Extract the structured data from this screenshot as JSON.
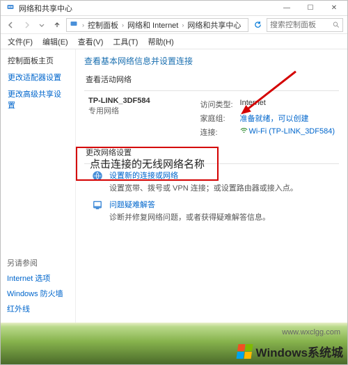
{
  "window": {
    "title": "网络和共享中心",
    "controls": {
      "min": "—",
      "max": "☐",
      "close": "✕"
    }
  },
  "breadcrumb": {
    "items": [
      "控制面板",
      "网络和 Internet",
      "网络和共享中心"
    ]
  },
  "search": {
    "placeholder": "搜索控制面板"
  },
  "menubar": {
    "items": [
      "文件(F)",
      "编辑(E)",
      "查看(V)",
      "工具(T)",
      "帮助(H)"
    ]
  },
  "sidebar": {
    "heading": "控制面板主页",
    "links": [
      "更改适配器设置",
      "更改高级共享设置"
    ]
  },
  "main": {
    "heading": "查看基本网络信息并设置连接",
    "section_active": "查看活动网络",
    "network": {
      "name": "TP-LINK_3DF584",
      "subtitle": "专用网络",
      "access_label": "访问类型:",
      "access_value": "Internet",
      "homegroup_label": "家庭组:",
      "homegroup_value": "准备就绪，可以创建",
      "connection_label": "连接:",
      "connection_value": "Wi-Fi (TP-LINK_3DF584)"
    },
    "section_change": "更改网络设置",
    "options": [
      {
        "title": "设置新的连接或网络",
        "desc": "设置宽带、拨号或 VPN 连接；或设置路由器或接入点。"
      },
      {
        "title": "问题疑难解答",
        "desc": "诊断并修复网络问题，或者获得疑难解答信息。"
      }
    ]
  },
  "annotation": {
    "callout_text": "点击连接的无线网络名称"
  },
  "related": {
    "heading": "另请参阅",
    "links": [
      "Internet 选项",
      "Windows 防火墙",
      "红外线"
    ]
  },
  "footer": {
    "brand": "Windows系统城",
    "url": "www.wxclgg.com"
  }
}
